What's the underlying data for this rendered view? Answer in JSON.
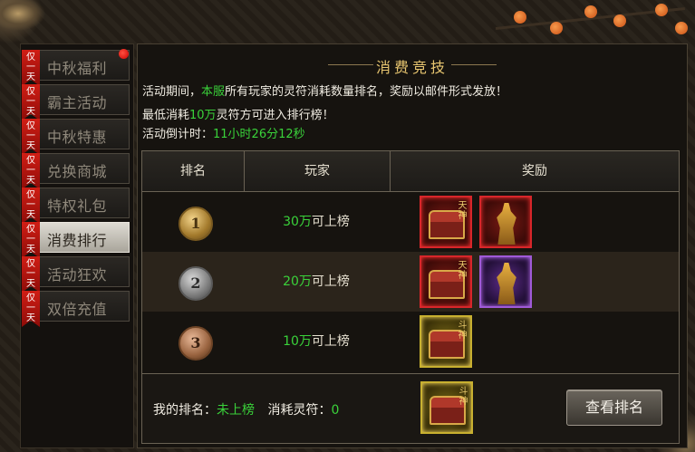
{
  "sidebar": {
    "badge": "仅一天",
    "items": [
      {
        "label": "中秋福利",
        "active": false,
        "has_dot": true
      },
      {
        "label": "霸主活动",
        "active": false
      },
      {
        "label": "中秋特惠",
        "active": false
      },
      {
        "label": "兑换商城",
        "active": false
      },
      {
        "label": "特权礼包",
        "active": false
      },
      {
        "label": "消费排行",
        "active": true
      },
      {
        "label": "活动狂欢",
        "active": false
      },
      {
        "label": "双倍充值",
        "active": false
      }
    ]
  },
  "main": {
    "title": "消费竞技",
    "desc_prefix": "活动期间，",
    "desc_highlight": "本服",
    "desc_suffix": "所有玩家的灵符消耗数量排名，奖励以邮件形式发放！",
    "min_prefix": "最低消耗",
    "min_value": "10万",
    "min_suffix": "灵符方可进入排行榜！",
    "countdown_label": "活动倒计时：",
    "countdown_value": "11小时26分12秒",
    "table": {
      "headers": [
        "排名",
        "玩家",
        "奖励"
      ],
      "rows": [
        {
          "rank": "1",
          "amount": "30万",
          "suffix": "可上榜",
          "rewards": [
            {
              "type": "chest",
              "tag": "天神",
              "border": "red"
            },
            {
              "type": "warrior",
              "border": "red"
            }
          ]
        },
        {
          "rank": "2",
          "amount": "20万",
          "suffix": "可上榜",
          "rewards": [
            {
              "type": "chest",
              "tag": "天神",
              "border": "red"
            },
            {
              "type": "warrior",
              "border": "purple"
            }
          ]
        },
        {
          "rank": "3",
          "amount": "10万",
          "suffix": "可上榜",
          "rewards": [
            {
              "type": "chest",
              "tag": "斗神",
              "border": "gold"
            }
          ]
        }
      ]
    },
    "footer": {
      "my_rank_label": "我的排名：",
      "my_rank_value": "未上榜",
      "consumed_label": "消耗灵符：",
      "consumed_value": "0",
      "reward_tag": "斗神",
      "button_label": "查看排名"
    }
  },
  "colors": {
    "accent_green": "#3ad23a",
    "title_gold": "#e8c670",
    "active_tab": "#d0ccc2"
  }
}
